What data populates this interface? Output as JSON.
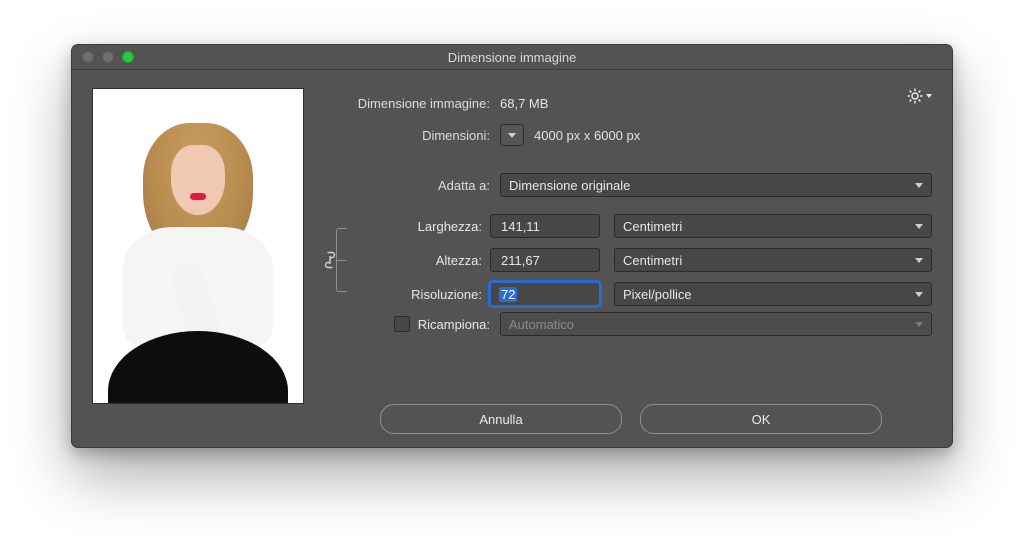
{
  "window": {
    "title": "Dimensione immagine"
  },
  "info": {
    "size_label": "Dimensione immagine:",
    "size_value": "68,7 MB",
    "dims_label": "Dimensioni:",
    "dims_value": "4000 px x 6000 px"
  },
  "fit": {
    "label": "Adatta a:",
    "value": "Dimensione originale"
  },
  "fields": {
    "width": {
      "label": "Larghezza:",
      "value": "141,11",
      "unit": "Centimetri"
    },
    "height": {
      "label": "Altezza:",
      "value": "211,67",
      "unit": "Centimetri"
    },
    "resolution": {
      "label": "Risoluzione:",
      "value": "72",
      "unit": "Pixel/pollice"
    }
  },
  "resample": {
    "label": "Ricampiona:",
    "value": "Automatico",
    "checked": false
  },
  "buttons": {
    "cancel": "Annulla",
    "ok": "OK"
  }
}
